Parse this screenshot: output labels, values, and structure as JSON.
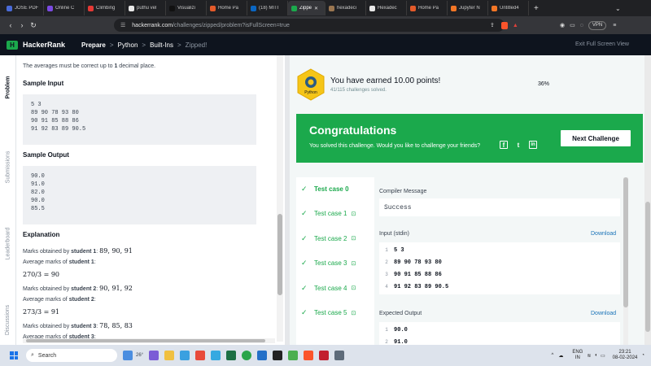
{
  "browser": {
    "tabs": [
      {
        "title": "JOSE PDF",
        "color": "#4a6bd8"
      },
      {
        "title": "Online C",
        "color": "#7b4ae2"
      },
      {
        "title": "Climbing",
        "color": "#e53935"
      },
      {
        "title": "puthu vel",
        "color": "#e8e8e8"
      },
      {
        "title": "Visualizi",
        "color": "#111111"
      },
      {
        "title": "Home Pa",
        "color": "#e35a2a"
      },
      {
        "title": "(18) MITI",
        "color": "#0a66c2"
      },
      {
        "title": "Zippe",
        "color": "#1ba94c",
        "active": true
      },
      {
        "title": "hexadeci",
        "color": "#9a7650"
      },
      {
        "title": "Hexadec",
        "color": "#e8e8e8"
      },
      {
        "title": "Home Pa",
        "color": "#e35a2a"
      },
      {
        "title": "Jupyter N",
        "color": "#f37626"
      },
      {
        "title": "Untitled4",
        "color": "#f37626"
      }
    ],
    "url_host": "hackerrank.com",
    "url_path": "/challenges/zipped/problem?isFullScreen=true",
    "vpn_label": "VPN"
  },
  "header": {
    "logo_mark": "H",
    "logo_text": "HackerRank",
    "crumbs": [
      "Prepare",
      "Python",
      "Built-Ins",
      "Zipped!"
    ],
    "crumb_sep": ">",
    "exit_fullscreen": "Exit Full Screen View"
  },
  "sidebar": {
    "tabs": [
      "Problem",
      "Submissions",
      "Leaderboard",
      "Discussions"
    ]
  },
  "problem": {
    "averages_note_pre": "The averages must be correct up to ",
    "averages_note_num": "1",
    "averages_note_post": " decimal place.",
    "sample_input_title": "Sample Input",
    "sample_input": "5 3\n89 90 78 93 80\n90 91 85 88 86\n91 92 83 89 90.5",
    "sample_output_title": "Sample Output",
    "sample_output": "90.0\n91.0\n82.0\n90.0\n85.5",
    "explanation_title": "Explanation",
    "marks_prefix": "Marks obtained by ",
    "avg_prefix": "Average marks of ",
    "students": [
      {
        "label": "student 1",
        "marks": "89, 90, 91",
        "calc": "270/3 = 90"
      },
      {
        "label": "student 2",
        "marks": "90, 91, 92",
        "calc": "273/3 = 91"
      },
      {
        "label": "student 3",
        "marks": "78, 85, 83",
        "calc": ""
      }
    ]
  },
  "result": {
    "earned": "You have earned 10.00 points!",
    "solved": "41/115 challenges solved.",
    "progress": "36%",
    "badge_label": "Python",
    "congrats_title": "Congratulations",
    "congrats_sub": "You solved this challenge. Would you like to challenge your friends?",
    "next_button": "Next Challenge",
    "social_icons": [
      "facebook-icon",
      "twitter-icon",
      "linkedin-icon"
    ]
  },
  "testcases": [
    {
      "label": "Test case 0",
      "locked": false,
      "active": true
    },
    {
      "label": "Test case 1",
      "locked": true
    },
    {
      "label": "Test case 2",
      "locked": true
    },
    {
      "label": "Test case 3",
      "locked": true
    },
    {
      "label": "Test case 4",
      "locked": true
    },
    {
      "label": "Test case 5",
      "locked": true
    }
  ],
  "testcase_detail": {
    "compiler_label": "Compiler Message",
    "compiler_message": "Success",
    "input_label": "Input (stdin)",
    "download": "Download",
    "input_lines": [
      "5 3",
      "89 90 78 93 80",
      "90 91 85 88 86",
      "91 92 83 89 90.5"
    ],
    "expected_label": "Expected Output",
    "expected_lines": [
      "90.0",
      "91.0"
    ]
  },
  "taskbar": {
    "search_placeholder": "Search",
    "weather": "26°",
    "lang_top": "ENG",
    "lang_bottom": "IN",
    "time": "23:21",
    "date": "08-02-2024"
  }
}
